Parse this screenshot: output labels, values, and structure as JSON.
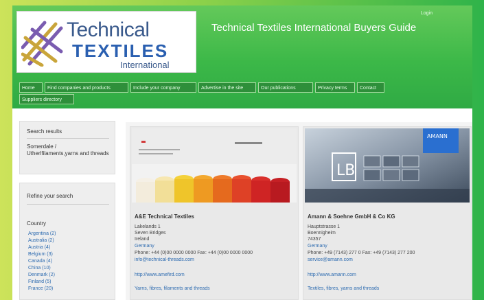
{
  "header": {
    "login": "Login",
    "title": "Technical Textiles International Buyers Guide",
    "logo": {
      "line1": "Technical",
      "line2": "TEXTILES",
      "line3": "International"
    }
  },
  "nav": {
    "items": [
      "Home",
      "Find companies and products",
      "Include your company",
      "Advertise in the site",
      "Our publications",
      "Privacy terms",
      "Contact",
      "Suppliers directory"
    ]
  },
  "sidebar": {
    "search_results": {
      "title": "Search results",
      "text": "Somerdale / Utherlfilaments,yarns and threads"
    },
    "refine": {
      "title": "Refine your search",
      "section": "Country",
      "items": [
        "Argentina (2)",
        "Australia (2)",
        "Austria (4)",
        "Belgium (3)",
        "Canada (4)",
        "China (10)",
        "Denmark (2)",
        "Finland (5)",
        "France (20)"
      ]
    }
  },
  "listings": [
    {
      "name": "A&E Technical Textiles",
      "address": [
        "Lakelands 1",
        "Seven Bridges",
        "Ireland",
        "Germany"
      ],
      "phone": "Phone: +44 (0)00 0000 0000 Fax: +44 (0)00 0000 0000",
      "email": "info@technical-threads.com",
      "web": "http://www.amefird.com",
      "products": "Yarns, fibres, filaments and threads"
    },
    {
      "name": "Amann & Soehne GmbH & Co KG",
      "address": [
        "Hauptstrasse 1",
        "Boennigheim",
        "74357",
        "Germany"
      ],
      "phone": "Phone: +49 (7143) 277 0 Fax: +49 (7143) 277 200",
      "email": "service@amann.com",
      "web": "http://www.amann.com",
      "products": "Textiles, fibres, yarns and threads"
    }
  ],
  "badge": "AMANN"
}
